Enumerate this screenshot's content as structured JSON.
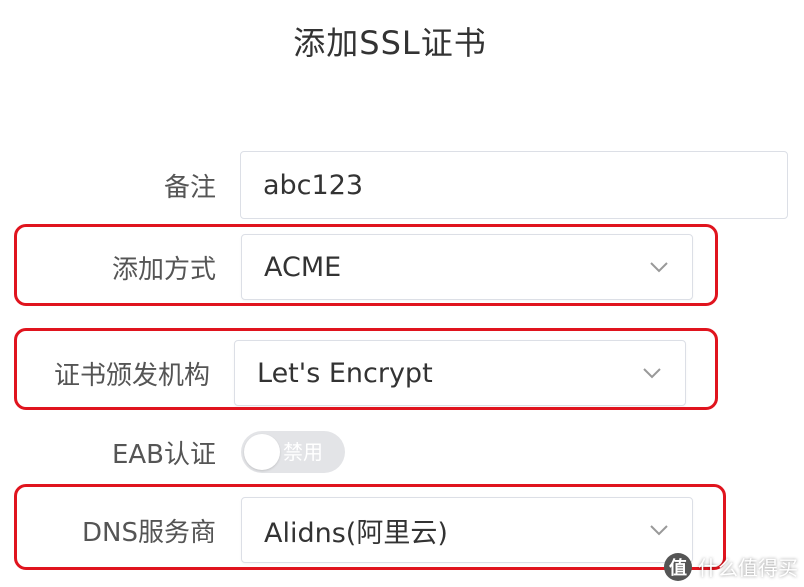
{
  "dialog": {
    "title": "添加SSL证书"
  },
  "form": {
    "remark": {
      "label": "备注",
      "value": "abc123"
    },
    "add_method": {
      "label": "添加方式",
      "value": "ACME"
    },
    "issuer": {
      "label": "证书颁发机构",
      "value": "Let's Encrypt"
    },
    "eab": {
      "label": "EAB认证",
      "toggle_text": "禁用",
      "enabled": false
    },
    "dns_provider": {
      "label": "DNS服务商",
      "value": "Alidns(阿里云)"
    }
  },
  "icons": {
    "select_arrow": "chevron-down-icon"
  },
  "colors": {
    "highlight": "#e0141e",
    "input_border": "#dcdfe6",
    "toggle_off": "#e3e4e7"
  },
  "watermark": {
    "logo_text": "值",
    "text": "什么值得买"
  }
}
